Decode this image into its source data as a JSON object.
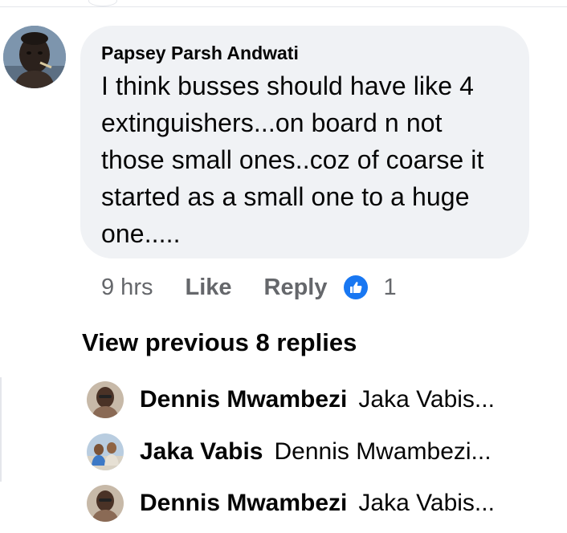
{
  "comment": {
    "author": "Papsey Parsh Andwati",
    "lines": [
      "I think busses should have like 4",
      "extinguishers...on board n not",
      "those small ones..coz of coarse it",
      "started as a small one to a huge",
      "one....."
    ],
    "time": "9 hrs",
    "like_label": "Like",
    "reply_label": "Reply",
    "reaction_icon": "thumbs-up-icon",
    "reaction_count": "1"
  },
  "view_previous": "View previous 8 replies",
  "replies": [
    {
      "name": "Dennis Mwambezi",
      "snippet": "Jaka Vabis..."
    },
    {
      "name": "Jaka Vabis",
      "snippet": "Dennis Mwambezi..."
    },
    {
      "name": "Dennis Mwambezi",
      "snippet": "Jaka Vabis..."
    }
  ],
  "colors": {
    "bubble_bg": "#f0f2f5",
    "meta_text": "#65676b",
    "like_blue": "#1877f2",
    "text": "#050505"
  }
}
